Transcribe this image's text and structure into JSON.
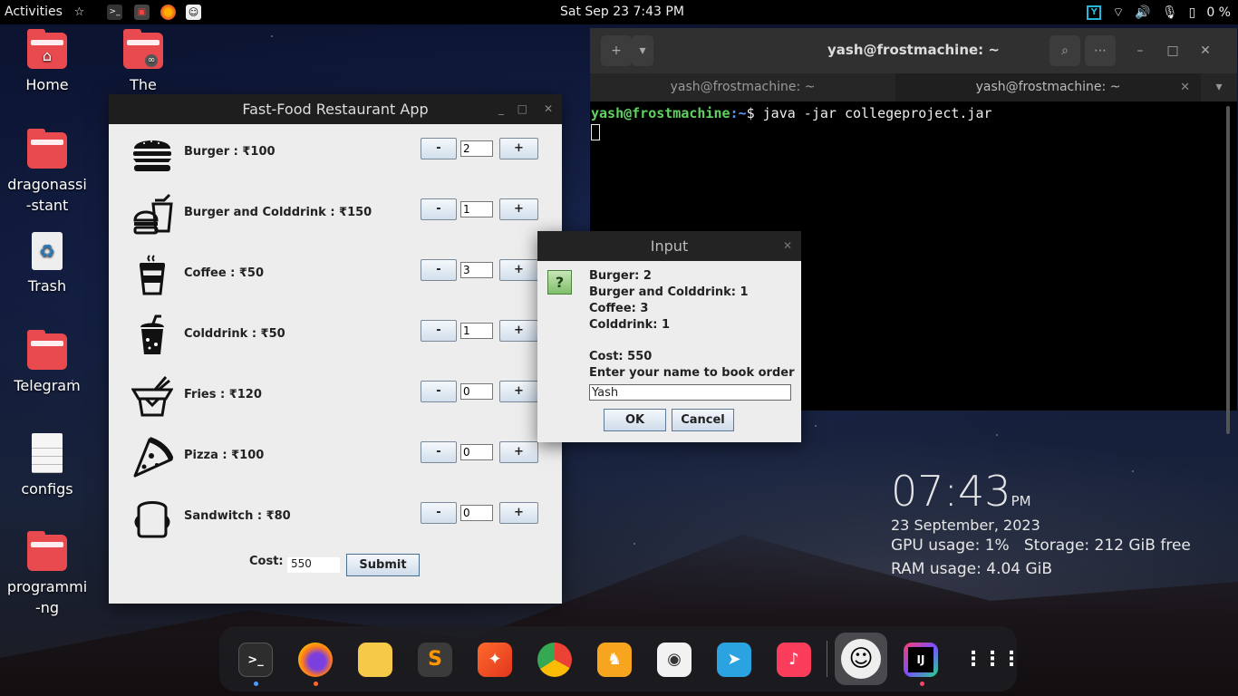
{
  "topbar": {
    "activities": "Activities",
    "datetime": "Sat Sep 23  7:43 PM",
    "battery": "0 %"
  },
  "desktop": {
    "icons": [
      {
        "label": "Home"
      },
      {
        "label": "The"
      },
      {
        "label": "dragonassi-stant"
      },
      {
        "label": "Trash"
      },
      {
        "label": "Telegram"
      },
      {
        "label": "configs"
      },
      {
        "label": "programmi-ng"
      }
    ]
  },
  "app": {
    "title": "Fast-Food Restaurant App",
    "items": [
      {
        "label": "Burger  : ₹100",
        "qty": "2",
        "icon": "burger-icon"
      },
      {
        "label": "Burger and Colddrink  : ₹150",
        "qty": "1",
        "icon": "burger-drink-icon"
      },
      {
        "label": "Coffee  : ₹50",
        "qty": "3",
        "icon": "coffee-icon"
      },
      {
        "label": "Colddrink  : ₹50",
        "qty": "1",
        "icon": "colddrink-icon"
      },
      {
        "label": "Fries  : ₹120",
        "qty": "0",
        "icon": "fries-icon"
      },
      {
        "label": "Pizza  : ₹100",
        "qty": "0",
        "icon": "pizza-icon"
      },
      {
        "label": "Sandwitch  : ₹80",
        "qty": "0",
        "icon": "sandwich-icon"
      }
    ],
    "minus_label": "-",
    "plus_label": "+",
    "cost_label": "Cost:",
    "cost_value": "550",
    "submit_label": "Submit"
  },
  "terminal": {
    "title": "yash@frostmachine: ~",
    "tabs": [
      "yash@frostmachine: ~",
      "yash@frostmachine: ~"
    ],
    "prompt_user": "yash@frostmachine",
    "prompt_path": ":~",
    "prompt_symbol": "$ ",
    "command": "java -jar collegeproject.jar"
  },
  "dialog": {
    "title": "Input",
    "lines": [
      "Burger: 2",
      "Burger and Colddrink: 1",
      "Coffee: 3",
      "Colddrink: 1"
    ],
    "cost": "Cost: 550",
    "prompt": "Enter your name to book order",
    "input_value": "Yash",
    "ok_label": "OK",
    "cancel_label": "Cancel"
  },
  "widget": {
    "time": "07:43",
    "ampm": "PM",
    "date": "23 September, 2023",
    "gpu": "GPU usage: 1%",
    "storage": "Storage: 212 GiB free",
    "ram": "RAM usage: 4.04 GiB"
  },
  "dock": {
    "terminal_glyph": ">_",
    "intellij_glyph": "IJ"
  }
}
